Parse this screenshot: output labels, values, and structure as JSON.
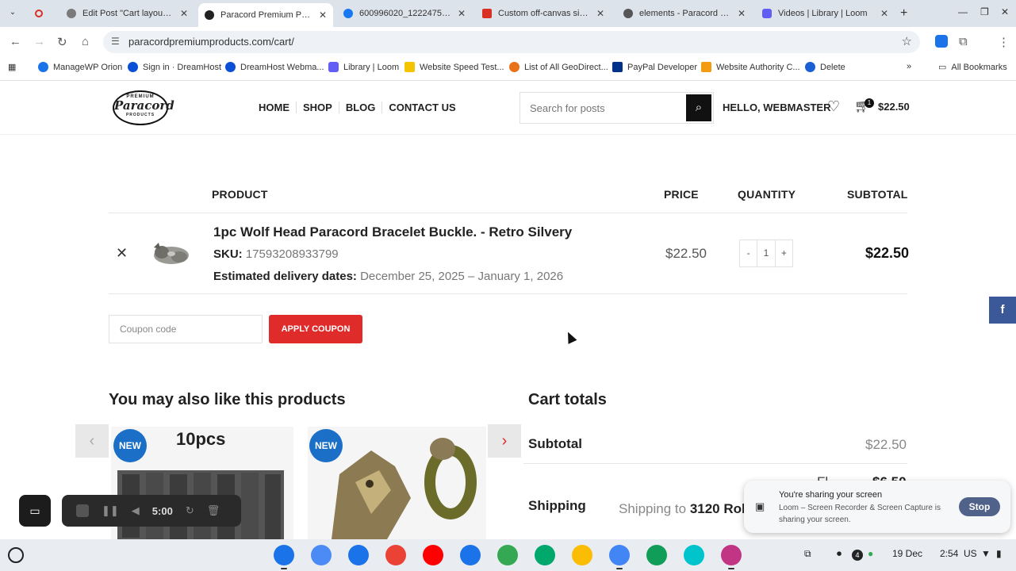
{
  "browser": {
    "tabs": [
      {
        "title": "Edit Post \"Cart layout\" ‹ P",
        "color": "#2271b1"
      },
      {
        "title": "Paracord Premium Produ",
        "color": "#111111",
        "active": true
      },
      {
        "title": "600996020_122247540…",
        "color": "#1877f2"
      },
      {
        "title": "Custom off-canvas sideb",
        "color": "#d93025"
      },
      {
        "title": "elements - Paracord Prem",
        "color": "#555555"
      },
      {
        "title": "Videos | Library | Loom",
        "color": "#625df5"
      }
    ],
    "url": "paracordpremiumproducts.com/cart/",
    "bookmarks": [
      {
        "label": "ManageWP Orion",
        "color": "#1a73e8"
      },
      {
        "label": "Sign in · DreamHost",
        "color": "#0a4fd6"
      },
      {
        "label": "DreamHost Webma...",
        "color": "#0a4fd6"
      },
      {
        "label": "Library | Loom",
        "color": "#625df5"
      },
      {
        "label": "Website Speed Test...",
        "color": "#f5c400"
      },
      {
        "label": "List of All GeoDirect...",
        "color": "#e8711a"
      },
      {
        "label": "PayPal Developer",
        "color": "#003087"
      },
      {
        "label": "Website Authority C...",
        "color": "#f39c12"
      },
      {
        "label": "Delete",
        "color": "#1a5fd6"
      }
    ],
    "all_bookmarks": "All Bookmarks"
  },
  "site": {
    "logo_top": "PREMIUM",
    "logo_main": "Paracord",
    "logo_bottom": "PRODUCTS",
    "nav": [
      "HOME",
      "SHOP",
      "BLOG",
      "CONTACT US"
    ],
    "search_placeholder": "Search for posts",
    "greeting": "HELLO, WEBMASTER",
    "cart_count": "1",
    "cart_total": "$22.50"
  },
  "cart": {
    "headers": {
      "product": "PRODUCT",
      "price": "PRICE",
      "quantity": "QUANTITY",
      "subtotal": "SUBTOTAL"
    },
    "item": {
      "name": "1pc Wolf Head Paracord Bracelet Buckle. - Retro Silvery",
      "sku_label": "SKU:",
      "sku": "17593208933799",
      "delivery_label": "Estimated delivery dates:",
      "delivery": "December 25, 2025 – January 1, 2026",
      "price": "$22.50",
      "qty": "1",
      "qty_minus": "-",
      "qty_plus": "+",
      "subtotal": "$22.50"
    },
    "coupon_placeholder": "Coupon code",
    "coupon_button": "APPLY COUPON"
  },
  "upsell": {
    "title": "You may also like this products",
    "badge": "NEW",
    "card1_text": "10pcs"
  },
  "totals": {
    "title": "Cart totals",
    "subtotal_label": "Subtotal",
    "subtotal_value": "$22.50",
    "shipping_label": "Shipping",
    "shipping_text": "Shipping to",
    "shipping_address": "3120 Rob",
    "partial_label": "Fl",
    "partial_value": "$6.50"
  },
  "loom": {
    "time": "5:00"
  },
  "share_toast": {
    "title": "You're sharing your screen",
    "body": "Loom – Screen Recorder & Screen Capture is sharing your screen.",
    "stop": "Stop"
  },
  "shelf": {
    "apps": [
      "#1a73e8",
      "#4c8bf5",
      "#1a73e8",
      "#ea4335",
      "#ff0000",
      "#1a73e8",
      "#34a853",
      "#00a86b",
      "#fbbc04",
      "#4285f4",
      "#0f9d58",
      "#00c4cc",
      "#c13584"
    ],
    "date": "19 Dec",
    "time": "2:54",
    "region": "US",
    "notifications": "4"
  }
}
